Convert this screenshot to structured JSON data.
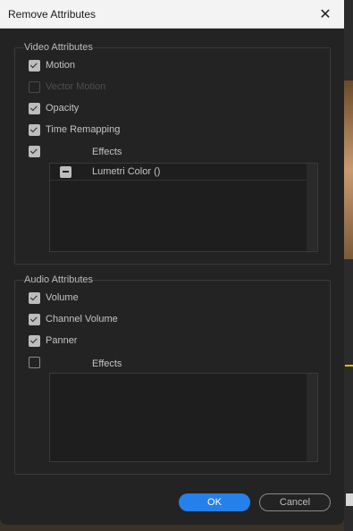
{
  "window": {
    "title": "Remove Attributes"
  },
  "video": {
    "group_label": "Video Attributes",
    "items": [
      {
        "label": "Motion",
        "checked": true,
        "enabled": true
      },
      {
        "label": "Vector Motion",
        "checked": false,
        "enabled": false
      },
      {
        "label": "Opacity",
        "checked": true,
        "enabled": true
      },
      {
        "label": "Time Remapping",
        "checked": true,
        "enabled": true
      }
    ],
    "effects": {
      "label": "Effects",
      "checked": true,
      "list": [
        {
          "name": "Lumetri Color ()",
          "state": "mixed"
        }
      ]
    }
  },
  "audio": {
    "group_label": "Audio Attributes",
    "items": [
      {
        "label": "Volume",
        "checked": true,
        "enabled": true
      },
      {
        "label": "Channel Volume",
        "checked": true,
        "enabled": true
      },
      {
        "label": "Panner",
        "checked": true,
        "enabled": true
      }
    ],
    "effects": {
      "label": "Effects",
      "checked": false,
      "list": []
    }
  },
  "buttons": {
    "ok": "OK",
    "cancel": "Cancel"
  },
  "colors": {
    "accent": "#2680eb",
    "dialog_bg": "#232323",
    "titlebar_bg": "#f3f3f3"
  }
}
